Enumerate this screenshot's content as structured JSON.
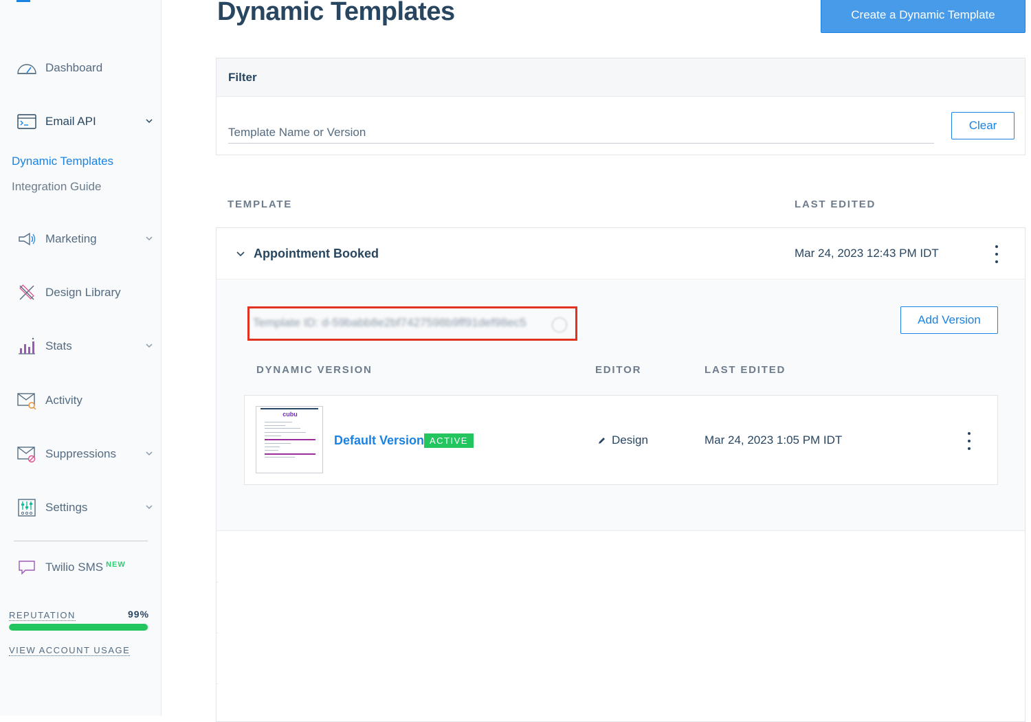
{
  "sidebar": {
    "items": [
      {
        "label": "Dashboard",
        "icon": "dashboard-gauge-icon"
      },
      {
        "label": "Email API",
        "icon": "email-api-terminal-icon"
      },
      {
        "label": "Marketing",
        "icon": "megaphone-icon"
      },
      {
        "label": "Design Library",
        "icon": "design-pencil-ruler-icon"
      },
      {
        "label": "Stats",
        "icon": "stats-bar-chart-icon"
      },
      {
        "label": "Activity",
        "icon": "activity-envelope-search-icon"
      },
      {
        "label": "Suppressions",
        "icon": "suppressions-envelope-block-icon"
      },
      {
        "label": "Settings",
        "icon": "settings-sliders-icon"
      }
    ],
    "sub_items": [
      "Dynamic Templates",
      "Integration Guide"
    ],
    "twilio": {
      "label": "Twilio SMS",
      "badge": "NEW"
    },
    "reputation": {
      "label": "REPUTATION",
      "value": "99%",
      "fraction": 0.99
    },
    "usage_link": "VIEW ACCOUNT USAGE"
  },
  "header": {
    "title": "Dynamic Templates",
    "create_button": "Create a Dynamic Template"
  },
  "filter": {
    "heading": "Filter",
    "placeholder": "Template Name or Version",
    "clear_button": "Clear"
  },
  "columns": {
    "template": "TEMPLATE",
    "last_edited": "LAST EDITED"
  },
  "template": {
    "name": "Appointment Booked",
    "last_edited": "Mar 24, 2023 12:43 PM IDT",
    "template_id": "Template ID: d-59babb8e2bf7427598b9ff91def98ec5",
    "add_version_button": "Add Version",
    "version_columns": {
      "version": "DYNAMIC VERSION",
      "editor": "EDITOR",
      "last_edited": "LAST EDITED"
    },
    "versions": [
      {
        "name": "Default Version",
        "status": "ACTIVE",
        "editor": "Design",
        "last_edited": "Mar 24, 2023 1:05 PM IDT",
        "thumbnail_logo": "cubu"
      }
    ]
  },
  "colors": {
    "accent": "#1a82e2",
    "primary_button": "#489be8",
    "active_badge": "#22c55e",
    "highlight_box": "#e0321e",
    "heading": "#294661"
  }
}
